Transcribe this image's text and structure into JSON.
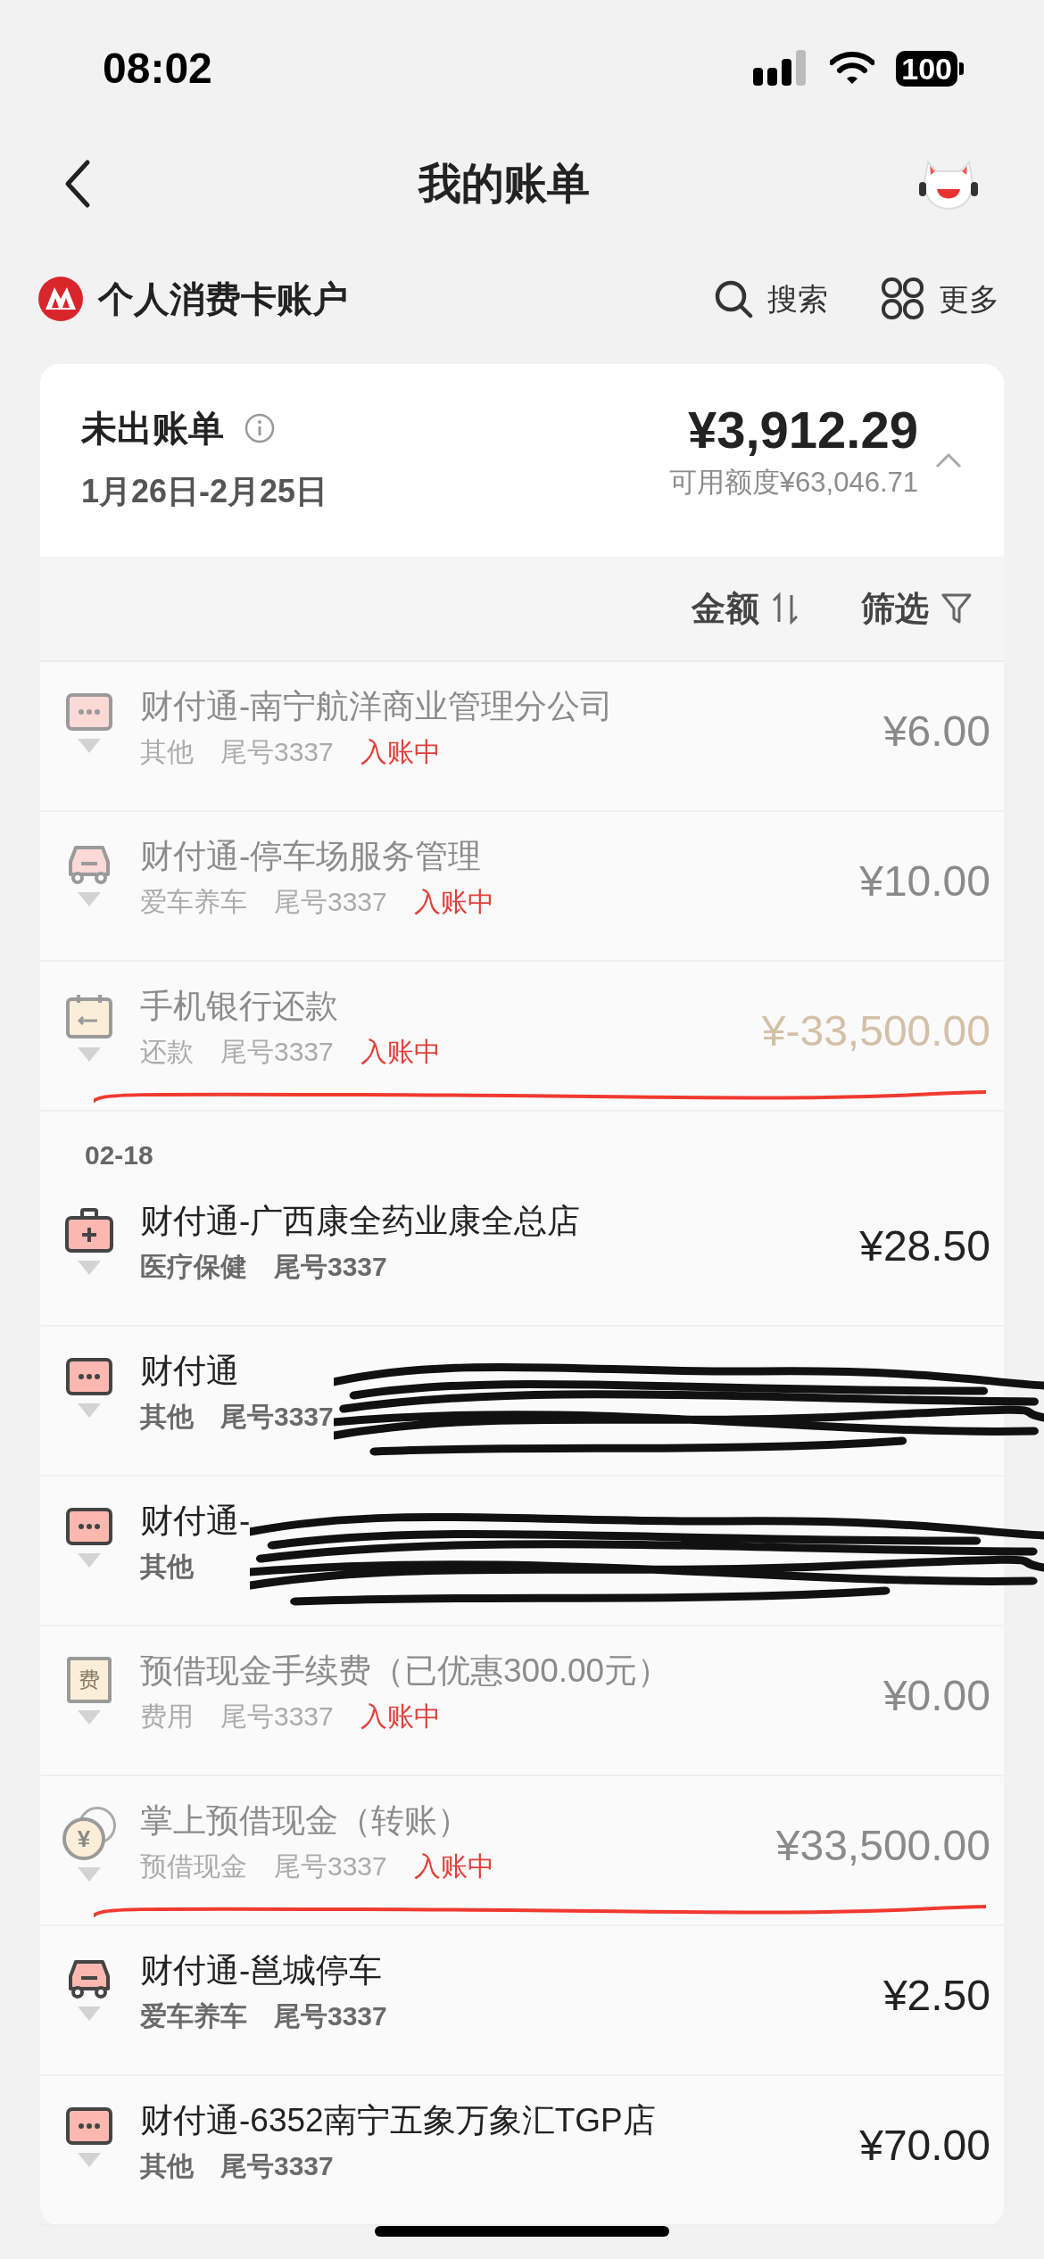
{
  "status_bar": {
    "time": "08:02",
    "battery": "100"
  },
  "nav": {
    "title": "我的账单"
  },
  "account": {
    "name": "个人消费卡账户",
    "actions": [
      {
        "label": "搜索",
        "kind": "search"
      },
      {
        "label": "更多",
        "kind": "more"
      }
    ]
  },
  "statement": {
    "title": "未出账单",
    "period": "1月26日-2月25日",
    "amount": "¥3,912.29",
    "available": "可用额度¥63,046.71",
    "expanded": true
  },
  "sort_bar": [
    {
      "label": "金额",
      "kind": "sort"
    },
    {
      "label": "筛选",
      "kind": "filter"
    }
  ],
  "sections": [
    {
      "rows": [
        {
          "kind": "other",
          "title": "财付通-南宁航洋商业管理分公司",
          "category": "其他",
          "card": "尾号3337",
          "status": "入账中",
          "pending": true,
          "amount": "¥6.00",
          "color": "#8a8a8a",
          "redacted": false,
          "marked": false
        },
        {
          "kind": "car",
          "title": "财付通-停车场服务管理",
          "category": "爱车养车",
          "card": "尾号3337",
          "status": "入账中",
          "pending": true,
          "amount": "¥10.00",
          "color": "#8a8a8a",
          "redacted": false,
          "marked": false
        },
        {
          "kind": "repay",
          "title": "手机银行还款",
          "category": "还款",
          "card": "尾号3337",
          "status": "入账中",
          "pending": true,
          "amount": "¥-33,500.00",
          "color": "#d4c0a6",
          "redacted": false,
          "marked": true
        }
      ]
    },
    {
      "date": "02-18",
      "rows": [
        {
          "kind": "medical",
          "title": "财付通-广西康全药业康全总店",
          "category": "医疗保健",
          "card": "尾号3337",
          "pending": false,
          "amount": "¥28.50",
          "color": "#222222",
          "redacted": false,
          "marked": false
        },
        {
          "kind": "other",
          "title": "财付通",
          "category": "其他",
          "card": "尾号3337",
          "pending": false,
          "redacted": true,
          "marked": false
        },
        {
          "kind": "other",
          "title": "财付通-",
          "category": "其他",
          "pending": false,
          "redacted": true,
          "marked": false
        },
        {
          "kind": "fee",
          "icon_text": "费",
          "title": "预借现金手续费（已优惠300.00元）",
          "category": "费用",
          "card": "尾号3337",
          "status": "入账中",
          "pending": true,
          "amount": "¥0.00",
          "color": "#8a8a8a",
          "redacted": false,
          "marked": false
        },
        {
          "kind": "cash",
          "icon_text": "¥",
          "title": "掌上预借现金（转账）",
          "category": "预借现金",
          "card": "尾号3337",
          "status": "入账中",
          "pending": true,
          "amount": "¥33,500.00",
          "color": "#8a8a8a",
          "redacted": false,
          "marked": true
        },
        {
          "kind": "car",
          "title": "财付通-邕城停车",
          "category": "爱车养车",
          "card": "尾号3337",
          "pending": false,
          "amount": "¥2.50",
          "color": "#222222",
          "redacted": false,
          "marked": false
        },
        {
          "kind": "other",
          "title": "财付通-6352南宁五象万象汇TGP店",
          "category": "其他",
          "card": "尾号3337",
          "pending": false,
          "amount": "¥70.00",
          "color": "#222222",
          "redacted": false,
          "marked": false
        }
      ]
    }
  ]
}
